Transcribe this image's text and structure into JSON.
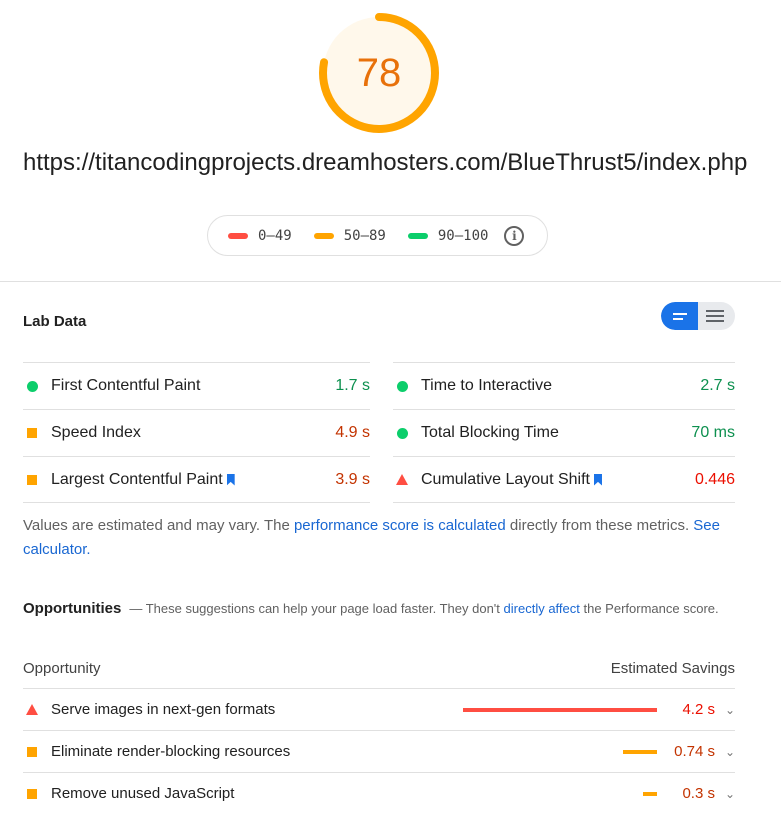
{
  "score": {
    "value": 78,
    "fraction": 0.78,
    "color": "#ffa400"
  },
  "url": "https://titancodingprojects.dreamhosters.com/BlueThrust5/index.php",
  "legend": {
    "items": [
      {
        "label": "0–49",
        "color": "#ff4e42"
      },
      {
        "label": "50–89",
        "color": "#ffa400"
      },
      {
        "label": "90–100",
        "color": "#0cce6b"
      }
    ],
    "info_icon": "info-icon"
  },
  "lab": {
    "title": "Lab Data",
    "metrics_left": [
      {
        "name": "First Contentful Paint",
        "value": "1.7 s",
        "status": "pass",
        "bookmark": false
      },
      {
        "name": "Speed Index",
        "value": "4.9 s",
        "status": "average",
        "bookmark": false
      },
      {
        "name": "Largest Contentful Paint",
        "value": "3.9 s",
        "status": "average",
        "bookmark": true
      }
    ],
    "metrics_right": [
      {
        "name": "Time to Interactive",
        "value": "2.7 s",
        "status": "pass",
        "bookmark": false
      },
      {
        "name": "Total Blocking Time",
        "value": "70 ms",
        "status": "pass",
        "bookmark": false
      },
      {
        "name": "Cumulative Layout Shift",
        "value": "0.446",
        "status": "fail",
        "bookmark": true
      }
    ],
    "status_colors": {
      "pass": "#0d904f",
      "average": "#c33300",
      "fail": "#eb0f00"
    }
  },
  "note": {
    "text1": "Values are estimated and may vary. The ",
    "link1": "performance score is calculated",
    "text2": " directly from these metrics. ",
    "link2": "See calculator."
  },
  "opportunities": {
    "title": "Opportunities",
    "desc1": "— These suggestions can help your page load faster. They don't ",
    "desc_link": "directly affect",
    "desc2": " the Performance score.",
    "col_opportunity": "Opportunity",
    "col_savings": "Estimated Savings",
    "items": [
      {
        "name": "Serve images in next-gen formats",
        "savings": "4.2 s",
        "seconds": 4.2,
        "status": "fail",
        "bar_color": "#ff4e42"
      },
      {
        "name": "Eliminate render-blocking resources",
        "savings": "0.74 s",
        "seconds": 0.74,
        "status": "average",
        "bar_color": "#ffa400"
      },
      {
        "name": "Remove unused JavaScript",
        "savings": "0.3 s",
        "seconds": 0.3,
        "status": "average",
        "bar_color": "#ffa400"
      }
    ]
  }
}
